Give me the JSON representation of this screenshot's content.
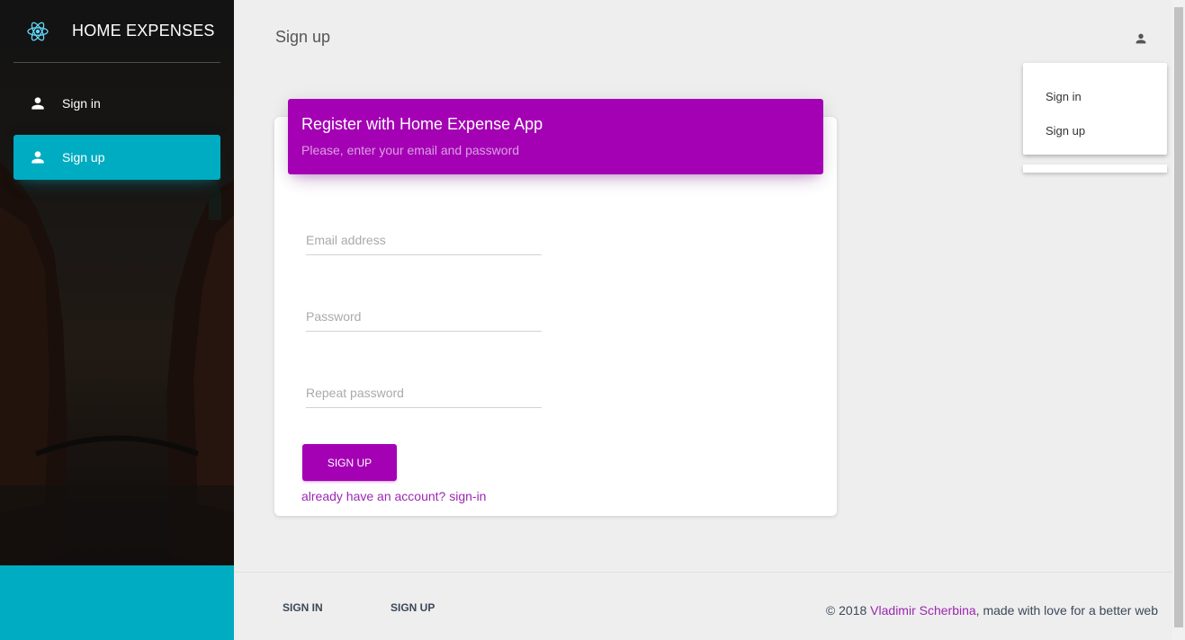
{
  "sidebar": {
    "brand_name": "HOME EXPENSES",
    "logo_icon": "react-atom-icon",
    "items": [
      {
        "label": "Sign in",
        "icon": "person-icon",
        "active": false
      },
      {
        "label": "Sign up",
        "icon": "person-icon",
        "active": true
      }
    ],
    "accent_color": "#00acc1"
  },
  "header": {
    "page_title": "Sign up",
    "user_icon": "person-icon"
  },
  "dropdown": {
    "items": [
      "Sign in",
      "Sign up"
    ]
  },
  "card": {
    "title": "Register with Home Expense App",
    "subtitle": "Please, enter your email and password",
    "header_color": "#a400b4",
    "fields": [
      {
        "placeholder": "Email address",
        "value": ""
      },
      {
        "placeholder": "Password",
        "value": ""
      },
      {
        "placeholder": "Repeat password",
        "value": ""
      }
    ],
    "submit_label": "SIGN UP",
    "signin_link": "already have an account? sign-in"
  },
  "footer": {
    "links": [
      "SIGN IN",
      "SIGN UP"
    ],
    "copyright_prefix": "© 2018 ",
    "author": "Vladimir Scherbina",
    "copyright_suffix": ", made with love for a better web"
  }
}
